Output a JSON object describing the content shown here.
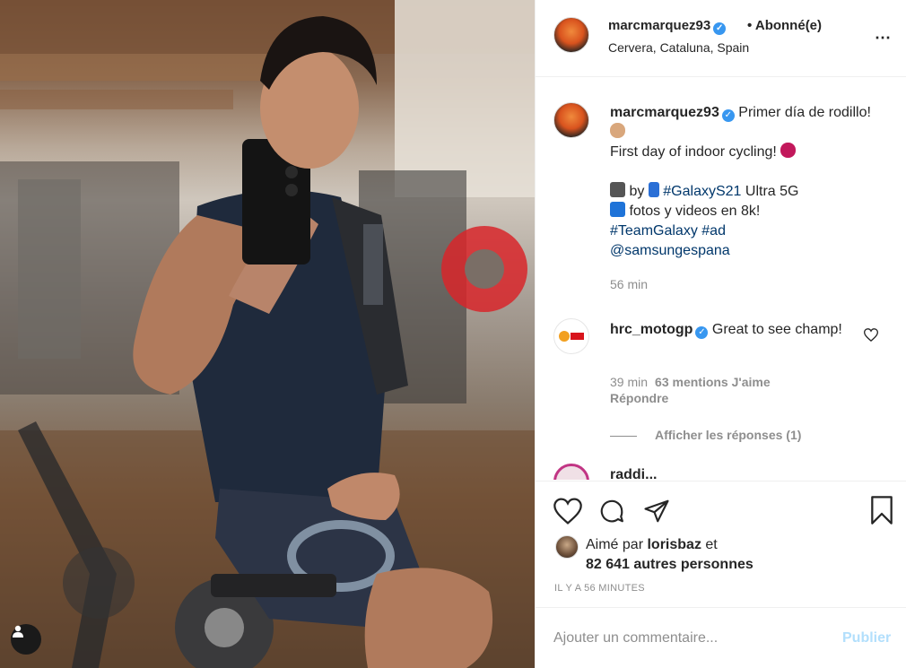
{
  "post": {
    "username": "marcmarquez93",
    "verified_mark": "✓",
    "follow_status": "• Abonné(e)",
    "location": "Cervera, Cataluna, Spain",
    "more_icon": "⋯"
  },
  "caption": {
    "username": "marcmarquez93",
    "line1": "Primer día de rodillo!",
    "line2": "First day of indoor cycling!",
    "line3_by": "by",
    "line3_tag": "#GalaxyS21",
    "line3_rest": "Ultra 5G",
    "line4": "fotos y videos en 8k!",
    "line5_tags": "#TeamGalaxy #ad",
    "line6_mention": "@samsungespana",
    "time": "56 min"
  },
  "comment": {
    "username": "hrc_motogp",
    "text": "Great to see champ!",
    "time": "39 min",
    "likes": "63 mentions J'aime",
    "reply": "Répondre",
    "show_replies": "Afficher les réponses (1)"
  },
  "next_comment": {
    "username": "raddi..."
  },
  "likes": {
    "prefix": "Aimé par",
    "user": "lorisbaz",
    "suffix": "et",
    "others": "82 641 autres personnes"
  },
  "timestamp": "IL Y A 56 MINUTES",
  "comment_input": {
    "placeholder": "Ajouter un commentaire...",
    "publish": "Publier"
  },
  "colors": {
    "accent_link": "#00376b",
    "verified": "#3897f0",
    "publish_disabled": "#b2dffc",
    "muted": "#8e8e8e"
  },
  "icons": [
    "heart-icon",
    "comment-icon",
    "share-icon",
    "bookmark-icon",
    "more-icon",
    "verified-icon",
    "user-tag-icon",
    "flexed-biceps-emoji",
    "cyclist-emoji",
    "camera-emoji",
    "phone-emoji",
    "top-emoji"
  ]
}
